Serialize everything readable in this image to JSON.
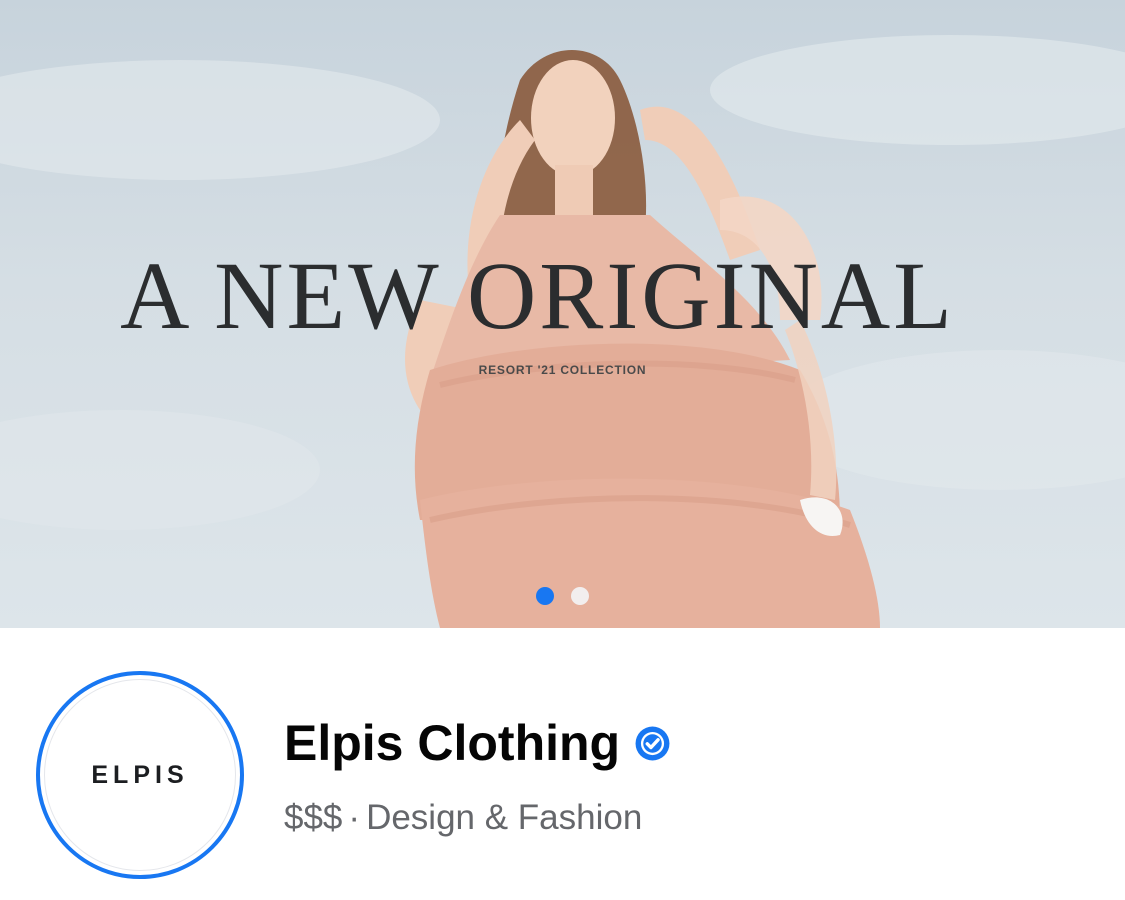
{
  "cover": {
    "headline": "A NEW ORIGINAL",
    "subheadline": "RESORT '21 COLLECTION",
    "carousel": {
      "total_slides": 2,
      "active_index": 0
    }
  },
  "profile": {
    "avatar_logo_text": "ELPIS",
    "page_name": "Elpis Clothing",
    "verified_icon": "verified-badge-icon",
    "price_range": "$$$",
    "separator": "·",
    "category": "Design & Fashion"
  },
  "colors": {
    "accent": "#1877f2",
    "name_text": "#050505",
    "meta_text": "#65676b",
    "dress": "#e8b9a6"
  }
}
